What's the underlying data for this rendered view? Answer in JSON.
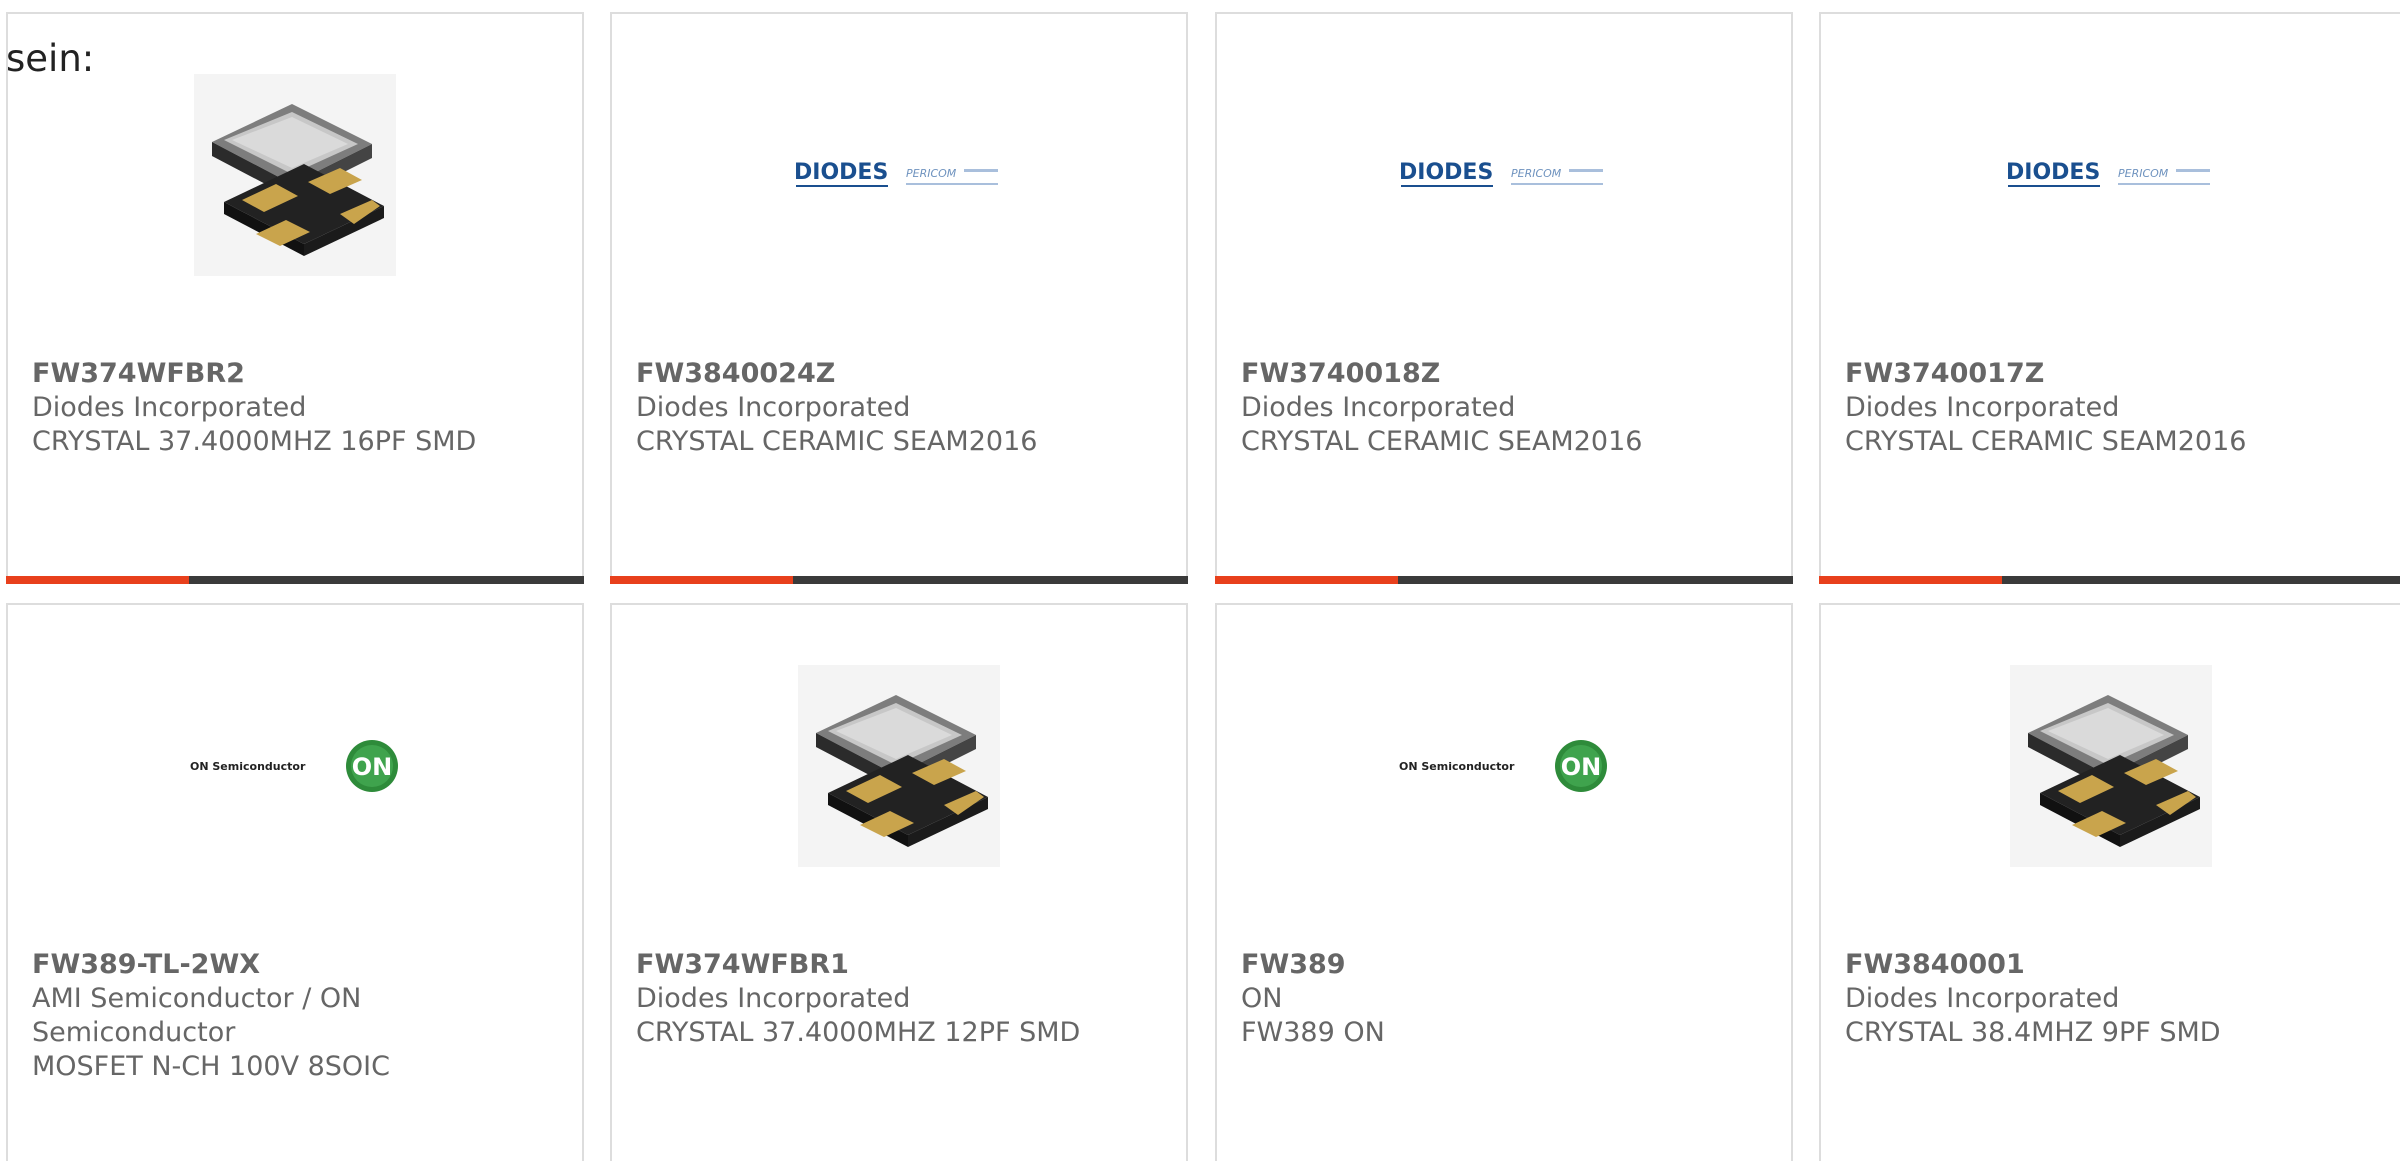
{
  "intro_text": "sein:",
  "colors": {
    "accent": "#e8401c",
    "accent_track": "#3a3a3a",
    "text": "#666666",
    "border": "#dddddd"
  },
  "products": [
    {
      "part": "FW374WFBR2",
      "manufacturer": "Diodes Incorporated",
      "description": "CRYSTAL 37.4000MHZ 16PF SMD",
      "image": "crystal-smd-icon"
    },
    {
      "part": "FW3840024Z",
      "manufacturer": "Diodes Incorporated",
      "description": "CRYSTAL CERAMIC SEAM2016",
      "image": "diodes-pericom-logo",
      "logo_text": "DIODES",
      "logo_sub": "PERICOM"
    },
    {
      "part": "FW3740018Z",
      "manufacturer": "Diodes Incorporated",
      "description": "CRYSTAL CERAMIC SEAM2016",
      "image": "diodes-pericom-logo",
      "logo_text": "DIODES",
      "logo_sub": "PERICOM"
    },
    {
      "part": "FW3740017Z",
      "manufacturer": "Diodes Incorporated",
      "description": "CRYSTAL CERAMIC SEAM2016",
      "image": "diodes-pericom-logo",
      "logo_text": "DIODES",
      "logo_sub": "PERICOM"
    },
    {
      "part": "FW389-TL-2WX",
      "manufacturer": "AMI Semiconductor / ON Semiconductor",
      "description": "MOSFET N-CH 100V 8SOIC",
      "image": "on-semiconductor-logo",
      "logo_text": "ON Semiconductor",
      "logo_badge": "ON"
    },
    {
      "part": "FW374WFBR1",
      "manufacturer": "Diodes Incorporated",
      "description": "CRYSTAL 37.4000MHZ 12PF SMD",
      "image": "crystal-smd-icon"
    },
    {
      "part": "FW389",
      "manufacturer": "ON",
      "description": "FW389 ON",
      "image": "on-semiconductor-logo",
      "logo_text": "ON Semiconductor",
      "logo_badge": "ON"
    },
    {
      "part": "FW3840001",
      "manufacturer": "Diodes Incorporated",
      "description": "CRYSTAL 38.4MHZ 9PF SMD",
      "image": "crystal-smd-icon"
    }
  ]
}
